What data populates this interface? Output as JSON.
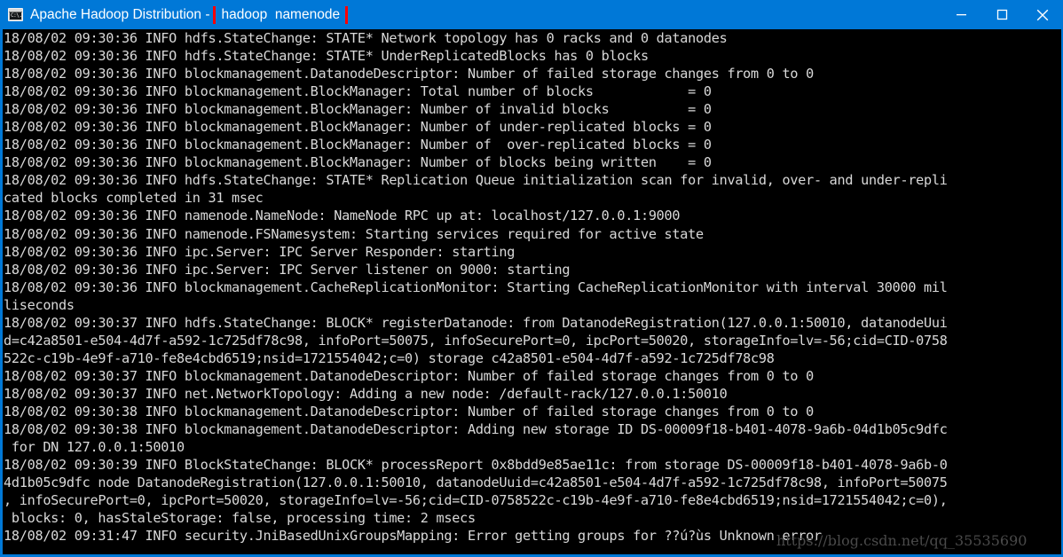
{
  "window": {
    "title_prefix": "Apache Hadoop Distribution - ",
    "title_highlighted": "hadoop  namenode",
    "icon_name": "console-app-icon",
    "icon_glyph": "C:\\.",
    "accent_color": "#0078d7",
    "highlight_color": "#ff0000",
    "console_bg": "#000000",
    "console_fg": "#d9d9d9",
    "controls": {
      "minimize_label": "Minimize",
      "maximize_label": "Maximize",
      "close_label": "Close"
    }
  },
  "console": {
    "lines": [
      "18/08/02 09:30:36 INFO hdfs.StateChange: STATE* Network topology has 0 racks and 0 datanodes",
      "18/08/02 09:30:36 INFO hdfs.StateChange: STATE* UnderReplicatedBlocks has 0 blocks",
      "18/08/02 09:30:36 INFO blockmanagement.DatanodeDescriptor: Number of failed storage changes from 0 to 0",
      "18/08/02 09:30:36 INFO blockmanagement.BlockManager: Total number of blocks            = 0",
      "18/08/02 09:30:36 INFO blockmanagement.BlockManager: Number of invalid blocks          = 0",
      "18/08/02 09:30:36 INFO blockmanagement.BlockManager: Number of under-replicated blocks = 0",
      "18/08/02 09:30:36 INFO blockmanagement.BlockManager: Number of  over-replicated blocks = 0",
      "18/08/02 09:30:36 INFO blockmanagement.BlockManager: Number of blocks being written    = 0",
      "18/08/02 09:30:36 INFO hdfs.StateChange: STATE* Replication Queue initialization scan for invalid, over- and under-repli",
      "cated blocks completed in 31 msec",
      "18/08/02 09:30:36 INFO namenode.NameNode: NameNode RPC up at: localhost/127.0.0.1:9000",
      "18/08/02 09:30:36 INFO namenode.FSNamesystem: Starting services required for active state",
      "18/08/02 09:30:36 INFO ipc.Server: IPC Server Responder: starting",
      "18/08/02 09:30:36 INFO ipc.Server: IPC Server listener on 9000: starting",
      "18/08/02 09:30:36 INFO blockmanagement.CacheReplicationMonitor: Starting CacheReplicationMonitor with interval 30000 mil",
      "liseconds",
      "18/08/02 09:30:37 INFO hdfs.StateChange: BLOCK* registerDatanode: from DatanodeRegistration(127.0.0.1:50010, datanodeUui",
      "d=c42a8501-e504-4d7f-a592-1c725df78c98, infoPort=50075, infoSecurePort=0, ipcPort=50020, storageInfo=lv=-56;cid=CID-0758",
      "522c-c19b-4e9f-a710-fe8e4cbd6519;nsid=1721554042;c=0) storage c42a8501-e504-4d7f-a592-1c725df78c98",
      "18/08/02 09:30:37 INFO blockmanagement.DatanodeDescriptor: Number of failed storage changes from 0 to 0",
      "18/08/02 09:30:37 INFO net.NetworkTopology: Adding a new node: /default-rack/127.0.0.1:50010",
      "18/08/02 09:30:38 INFO blockmanagement.DatanodeDescriptor: Number of failed storage changes from 0 to 0",
      "18/08/02 09:30:38 INFO blockmanagement.DatanodeDescriptor: Adding new storage ID DS-00009f18-b401-4078-9a6b-04d1b05c9dfc",
      " for DN 127.0.0.1:50010",
      "18/08/02 09:30:39 INFO BlockStateChange: BLOCK* processReport 0x8bdd9e85ae11c: from storage DS-00009f18-b401-4078-9a6b-0",
      "4d1b05c9dfc node DatanodeRegistration(127.0.0.1:50010, datanodeUuid=c42a8501-e504-4d7f-a592-1c725df78c98, infoPort=50075",
      ", infoSecurePort=0, ipcPort=50020, storageInfo=lv=-56;cid=CID-0758522c-c19b-4e9f-a710-fe8e4cbd6519;nsid=1721554042;c=0),",
      " blocks: 0, hasStaleStorage: false, processing time: 2 msecs",
      "18/08/02 09:31:47 INFO security.JniBasedUnixGroupsMapping: Error getting groups for ??ú?ùs Unknown error"
    ]
  },
  "watermark": {
    "text": "https://blog.csdn.net/qq_35535690",
    "color": "#4a4a4a"
  }
}
